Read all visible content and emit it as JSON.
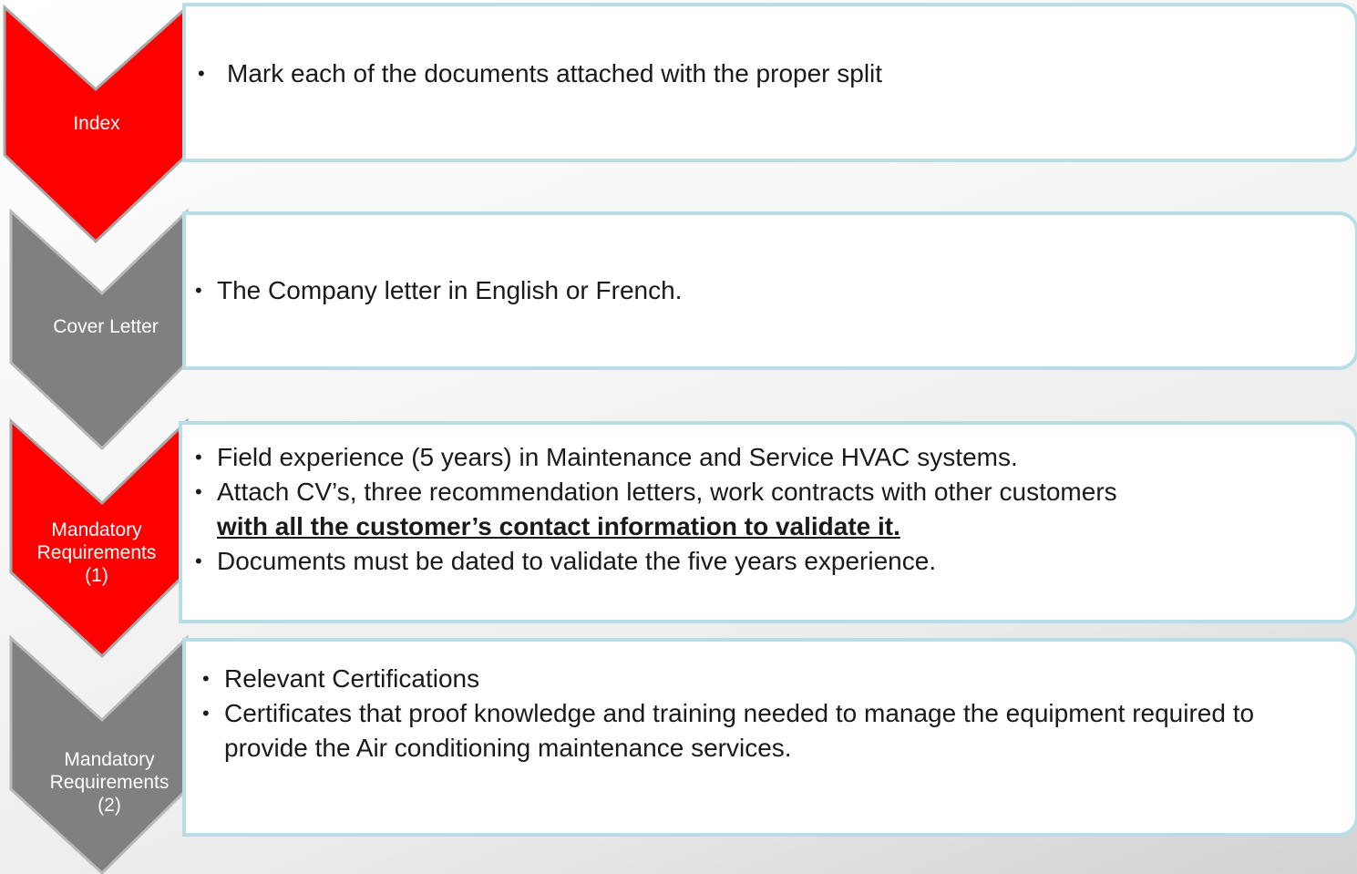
{
  "colors": {
    "red": "#ff0000",
    "red_border": "#a9a9a9",
    "gray": "#808080",
    "gray_border": "#b8b8b8",
    "box_border": "#b7dde6"
  },
  "steps": [
    {
      "label": "Index",
      "bullets": [
        {
          "text": "Mark each of the documents attached with the proper split"
        }
      ]
    },
    {
      "label": "Cover Letter",
      "bullets": [
        {
          "text": "The Company letter in English or French."
        }
      ]
    },
    {
      "label": "Mandatory\nRequirements\n(1)",
      "bullets": [
        {
          "text": "Field experience (5 years) in Maintenance and Service HVAC systems."
        },
        {
          "text": "Attach CV’s, three recommendation letters, work contracts with other customers",
          "emphasis": "with all the customer’s contact information to validate it."
        },
        {
          "text": "Documents must be dated to validate the five years experience."
        }
      ]
    },
    {
      "label": "Mandatory\nRequirements\n(2)",
      "bullets": [
        {
          "text": "Relevant Certifications"
        },
        {
          "text": "Certificates that proof knowledge and training needed to manage the equipment required to provide the Air conditioning maintenance services."
        }
      ]
    }
  ]
}
